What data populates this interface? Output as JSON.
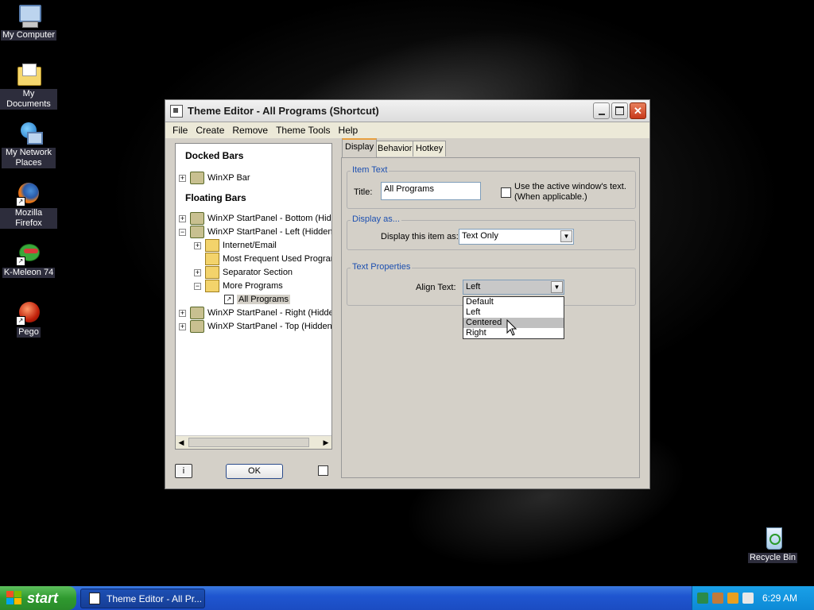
{
  "desktop": {
    "icons": [
      {
        "label": "My Computer"
      },
      {
        "label": "My Documents"
      },
      {
        "label": "My Network Places"
      },
      {
        "label": "Mozilla Firefox"
      },
      {
        "label": "K-Meleon 74"
      },
      {
        "label": "Pego"
      },
      {
        "label": "Recycle Bin"
      }
    ]
  },
  "window": {
    "title": "Theme Editor  -  All Programs  (Shortcut)",
    "menu": [
      "File",
      "Create",
      "Remove",
      "Theme Tools",
      "Help"
    ]
  },
  "tree": {
    "docked_heading": "Docked Bars",
    "floating_heading": "Floating Bars",
    "nodes": [
      {
        "label": "WinXP Bar",
        "toggle": "+"
      },
      {
        "label": "WinXP StartPanel - Bottom (Hidd",
        "toggle": "+"
      },
      {
        "label": "WinXP StartPanel - Left (Hidden)",
        "toggle": "−"
      },
      {
        "label": "Internet/Email",
        "toggle": "+"
      },
      {
        "label": "Most Frequent Used Program",
        "toggle": ""
      },
      {
        "label": "Separator Section",
        "toggle": "+"
      },
      {
        "label": "More Programs",
        "toggle": "−"
      },
      {
        "label": "All Programs",
        "toggle": ""
      },
      {
        "label": "WinXP StartPanel - Right (Hidder",
        "toggle": "+"
      },
      {
        "label": "WinXP StartPanel - Top (Hidden)",
        "toggle": "+"
      }
    ]
  },
  "buttons": {
    "info": "i",
    "ok": "OK"
  },
  "tabs": [
    "Display",
    "Behavior",
    "Hotkey"
  ],
  "item_text": {
    "group_label": "Item Text",
    "title_label": "Title:",
    "title_value": "All Programs",
    "use_active_label_1": "Use the active window's text.",
    "use_active_label_2": "(When applicable.)"
  },
  "display_as": {
    "group_label": "Display as...",
    "field_label": "Display this item as:",
    "value": "Text Only"
  },
  "text_properties": {
    "group_label": "Text Properties",
    "align_label": "Align Text:",
    "align_value": "Left",
    "options": [
      "Default",
      "Left",
      "Centered",
      "Right"
    ]
  },
  "taskbar": {
    "start": "start",
    "task": "Theme Editor  -  All Pr...",
    "clock": "6:29 AM"
  }
}
